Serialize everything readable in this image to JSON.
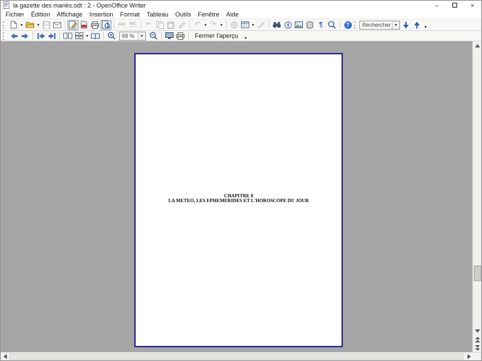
{
  "window": {
    "title": "la gazette des mariés.odt : 2 - OpenOffice Writer"
  },
  "glyphs": {
    "minimize": "–",
    "close": "×",
    "dropdown": "▾",
    "cut": "✂",
    "undo": "↶",
    "redo": "↷",
    "paragraph": "¶",
    "help": "?",
    "spell_abc": "ABC"
  },
  "menubar": {
    "items": [
      "Fichier",
      "Édition",
      "Affichage",
      "Insertion",
      "Format",
      "Tableau",
      "Outils",
      "Fenêtre",
      "Aide"
    ]
  },
  "standard_toolbar": {
    "icons": [
      "new-document",
      "open",
      "save",
      "send-email",
      "edit-file",
      "export-pdf",
      "print",
      "page-preview",
      "spellcheck",
      "auto-spellcheck",
      "cut",
      "copy",
      "paste",
      "format-paintbrush",
      "undo",
      "redo",
      "hyperlink",
      "insert-table",
      "show-draw-functions",
      "find-replace",
      "navigator",
      "gallery",
      "data-sources",
      "nonprinting-characters",
      "zoom",
      "help"
    ],
    "active_toggles": [
      "edit-file",
      "page-preview"
    ],
    "search": {
      "value": "Rechercher"
    }
  },
  "preview_toolbar": {
    "icons": [
      "previous-page",
      "next-page",
      "first-page",
      "last-page",
      "two-pages-preview",
      "multiple-pages-preview",
      "book-preview",
      "zoom-in",
      "zoom-level",
      "zoom-out",
      "full-screen",
      "print-page-preview",
      "close-preview"
    ],
    "zoom_value": "69 %",
    "close_preview_label": "Fermer l'aperçu"
  },
  "document_page": {
    "line1": "CHAPITRE 8",
    "line2": "LA METEO, LES EPHEMERIDES ET L'HOROSCOPE DU JOUR"
  },
  "colors": {
    "workspace_bg": "#a6a6a6",
    "page_border": "#26268f",
    "active_toggle_bg": "#cfe3f7",
    "accent_blue": "#3f6fae",
    "help_blue": "#2a6fd6",
    "pdf_red": "#d23333"
  }
}
